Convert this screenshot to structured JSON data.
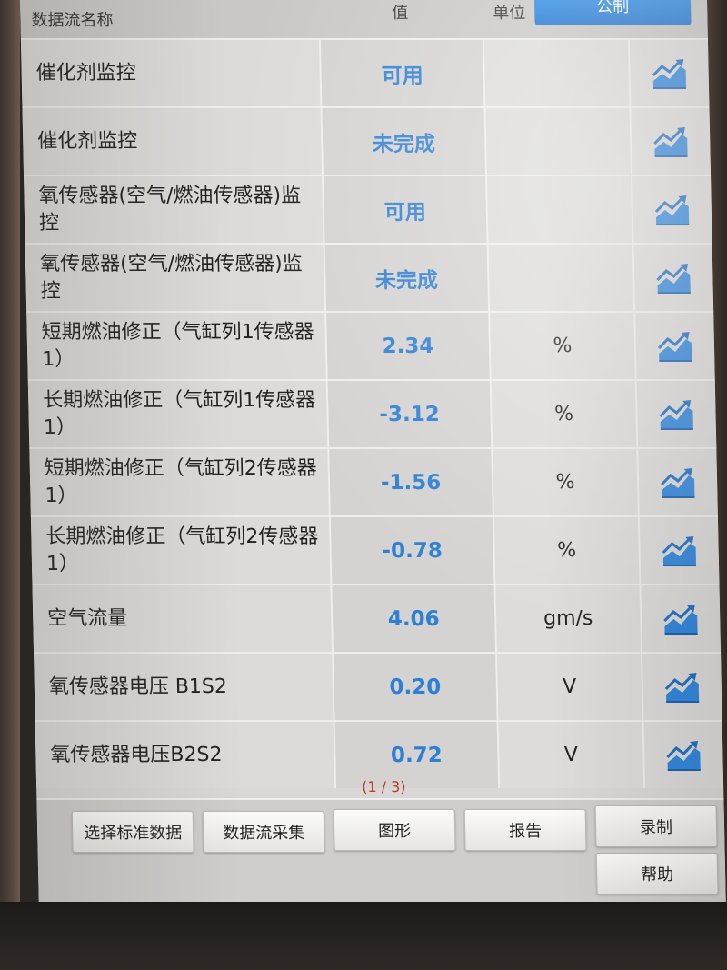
{
  "header": {
    "name_col": "数据流名称",
    "value_col": "值",
    "unit_col": "单位",
    "metric_button": "公制"
  },
  "rows": [
    {
      "name": "催化剂监控",
      "value": "可用",
      "unit": ""
    },
    {
      "name": "催化剂监控",
      "value": "未完成",
      "unit": ""
    },
    {
      "name": "氧传感器(空气/燃油传感器)监控",
      "value": "可用",
      "unit": ""
    },
    {
      "name": "氧传感器(空气/燃油传感器)监控",
      "value": "未完成",
      "unit": ""
    },
    {
      "name": "短期燃油修正（气缸列1传感器1）",
      "value": "2.34",
      "unit": "%"
    },
    {
      "name": "长期燃油修正（气缸列1传感器1）",
      "value": "-3.12",
      "unit": "%"
    },
    {
      "name": "短期燃油修正（气缸列2传感器1）",
      "value": "-1.56",
      "unit": "%"
    },
    {
      "name": "长期燃油修正（气缸列2传感器1）",
      "value": "-0.78",
      "unit": "%"
    },
    {
      "name": "空气流量",
      "value": "4.06",
      "unit": "gm/s"
    },
    {
      "name": "氧传感器电压 B1S2",
      "value": "0.20",
      "unit": "V"
    },
    {
      "name": "氧传感器电压B2S2",
      "value": "0.72",
      "unit": "V"
    }
  ],
  "row_icon": "line-graph-icon",
  "page_indicator": "(1 / 3)",
  "buttons": {
    "select_standard": "选择标准数据",
    "collect": "数据流采集",
    "graph": "图形",
    "report": "报告",
    "record": "录制",
    "help": "帮助"
  },
  "colors": {
    "accent": "#1e73d0",
    "value_text": "#2f7fd4",
    "page_indicator": "#c0392b"
  }
}
